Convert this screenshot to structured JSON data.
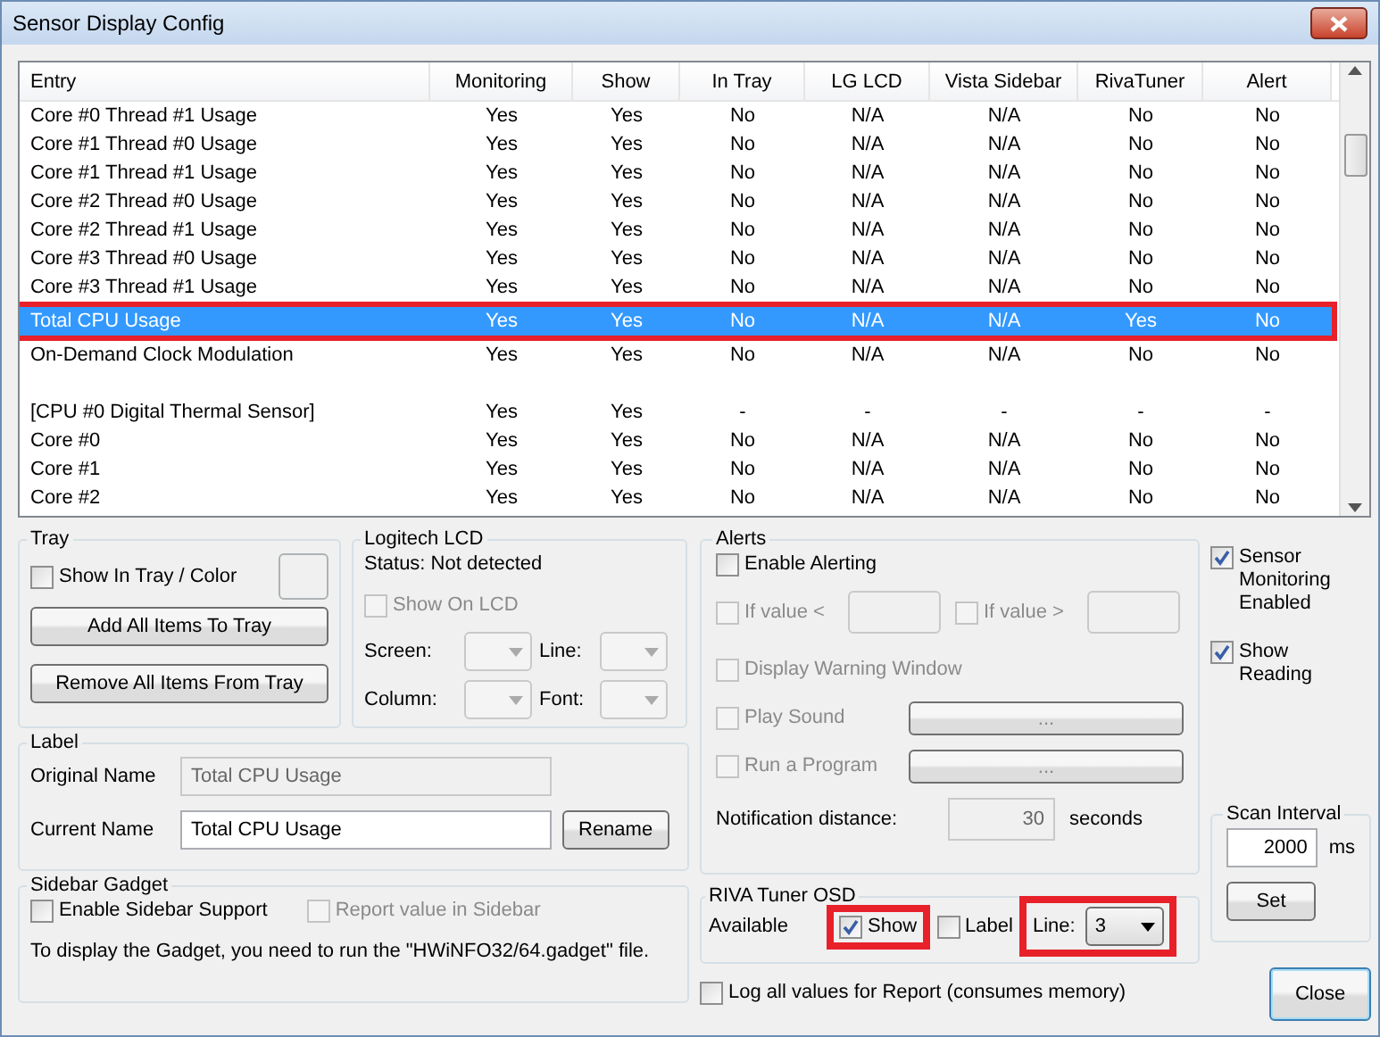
{
  "window": {
    "title": "Sensor Display Config"
  },
  "table": {
    "columns": [
      "Entry",
      "Monitoring",
      "Show",
      "In Tray",
      "LG LCD",
      "Vista Sidebar",
      "RivaTuner",
      "Alert"
    ],
    "rows": [
      {
        "kind": "sensor",
        "selected": false,
        "annotated": false,
        "cells": [
          "Core #0 Thread #1 Usage",
          "Yes",
          "Yes",
          "No",
          "N/A",
          "N/A",
          "No",
          "No"
        ]
      },
      {
        "kind": "sensor",
        "selected": false,
        "annotated": false,
        "cells": [
          "Core #1 Thread #0 Usage",
          "Yes",
          "Yes",
          "No",
          "N/A",
          "N/A",
          "No",
          "No"
        ]
      },
      {
        "kind": "sensor",
        "selected": false,
        "annotated": false,
        "cells": [
          "Core #1 Thread #1 Usage",
          "Yes",
          "Yes",
          "No",
          "N/A",
          "N/A",
          "No",
          "No"
        ]
      },
      {
        "kind": "sensor",
        "selected": false,
        "annotated": false,
        "cells": [
          "Core #2 Thread #0 Usage",
          "Yes",
          "Yes",
          "No",
          "N/A",
          "N/A",
          "No",
          "No"
        ]
      },
      {
        "kind": "sensor",
        "selected": false,
        "annotated": false,
        "cells": [
          "Core #2 Thread #1 Usage",
          "Yes",
          "Yes",
          "No",
          "N/A",
          "N/A",
          "No",
          "No"
        ]
      },
      {
        "kind": "sensor",
        "selected": false,
        "annotated": false,
        "cells": [
          "Core #3 Thread #0 Usage",
          "Yes",
          "Yes",
          "No",
          "N/A",
          "N/A",
          "No",
          "No"
        ]
      },
      {
        "kind": "sensor",
        "selected": false,
        "annotated": false,
        "cells": [
          "Core #3 Thread #1 Usage",
          "Yes",
          "Yes",
          "No",
          "N/A",
          "N/A",
          "No",
          "No"
        ]
      },
      {
        "kind": "sensor",
        "selected": true,
        "annotated": true,
        "cells": [
          "Total CPU Usage",
          "Yes",
          "Yes",
          "No",
          "N/A",
          "N/A",
          "Yes",
          "No"
        ]
      },
      {
        "kind": "sensor",
        "selected": false,
        "annotated": false,
        "cells": [
          "On-Demand Clock Modulation",
          "Yes",
          "Yes",
          "No",
          "N/A",
          "N/A",
          "No",
          "No"
        ]
      },
      {
        "kind": "blank"
      },
      {
        "kind": "sensor",
        "selected": false,
        "annotated": false,
        "cells": [
          "[CPU #0 Digital Thermal Sensor]",
          "Yes",
          "Yes",
          "-",
          "-",
          "-",
          "-",
          "-"
        ]
      },
      {
        "kind": "sensor",
        "selected": false,
        "annotated": false,
        "cells": [
          "Core #0",
          "Yes",
          "Yes",
          "No",
          "N/A",
          "N/A",
          "No",
          "No"
        ]
      },
      {
        "kind": "sensor",
        "selected": false,
        "annotated": false,
        "cells": [
          "Core #1",
          "Yes",
          "Yes",
          "No",
          "N/A",
          "N/A",
          "No",
          "No"
        ]
      },
      {
        "kind": "sensor",
        "selected": false,
        "annotated": false,
        "cells": [
          "Core #2",
          "Yes",
          "Yes",
          "No",
          "N/A",
          "N/A",
          "No",
          "No"
        ]
      }
    ]
  },
  "tray": {
    "title": "Tray",
    "show_in_tray": {
      "label": "Show In Tray / Color",
      "checked": false
    },
    "buttons": [
      "Add All Items To Tray",
      "Remove All Items From Tray"
    ]
  },
  "logitech_lcd": {
    "title": "Logitech LCD",
    "status": "Status: Not detected",
    "show_on_lcd": {
      "label": "Show On LCD",
      "checked": false,
      "disabled": true
    },
    "fields": [
      {
        "label": "Screen:"
      },
      {
        "label": "Line:"
      },
      {
        "label": "Column:"
      },
      {
        "label": "Font:"
      }
    ]
  },
  "label": {
    "title": "Label",
    "original_name": {
      "label": "Original Name",
      "value": "Total CPU Usage"
    },
    "current_name": {
      "label": "Current Name",
      "value": "Total CPU Usage"
    },
    "rename": "Rename"
  },
  "sidebar_gadget": {
    "title": "Sidebar Gadget",
    "enable": {
      "label": "Enable Sidebar Support",
      "checked": false,
      "disabled": false
    },
    "report": {
      "label": "Report value in Sidebar",
      "checked": false,
      "disabled": true
    },
    "note": "To display the Gadget, you need to run the \"HWiNFO32/64.gadget\" file."
  },
  "alerts": {
    "title": "Alerts",
    "enable": {
      "label": "Enable Alerting",
      "checked": false,
      "disabled": false
    },
    "if_less": {
      "label": "If value <",
      "checked": false,
      "disabled": true
    },
    "if_greater": {
      "label": "If value >",
      "checked": false,
      "disabled": true
    },
    "display_warning": {
      "label": "Display Warning Window",
      "checked": false,
      "disabled": true
    },
    "play_sound": {
      "label": "Play Sound",
      "checked": false,
      "disabled": true,
      "browse": "..."
    },
    "run_program": {
      "label": "Run a Program",
      "checked": false,
      "disabled": true,
      "browse": "..."
    },
    "notification": {
      "label": "Notification distance:",
      "value": "30",
      "unit": "seconds"
    }
  },
  "riva_tuner": {
    "title": "RIVA Tuner OSD",
    "available": "Available",
    "show": {
      "label": "Show",
      "checked": true,
      "disabled": false,
      "annotated": true
    },
    "label": {
      "label": "Label",
      "checked": false,
      "disabled": false
    },
    "line": {
      "label": "Line:",
      "value": "3",
      "annotated": true
    }
  },
  "log_all": {
    "label": "Log all values for Report (consumes memory)",
    "checked": false,
    "disabled": false
  },
  "sensor_monitoring": {
    "label": "Sensor Monitoring Enabled",
    "checked": true,
    "disabled": false
  },
  "show_reading": {
    "label": "Show Reading",
    "checked": true,
    "disabled": false
  },
  "scan_interval": {
    "title": "Scan Interval",
    "value": "2000",
    "unit": "ms",
    "button": "Set"
  },
  "close": "Close"
}
